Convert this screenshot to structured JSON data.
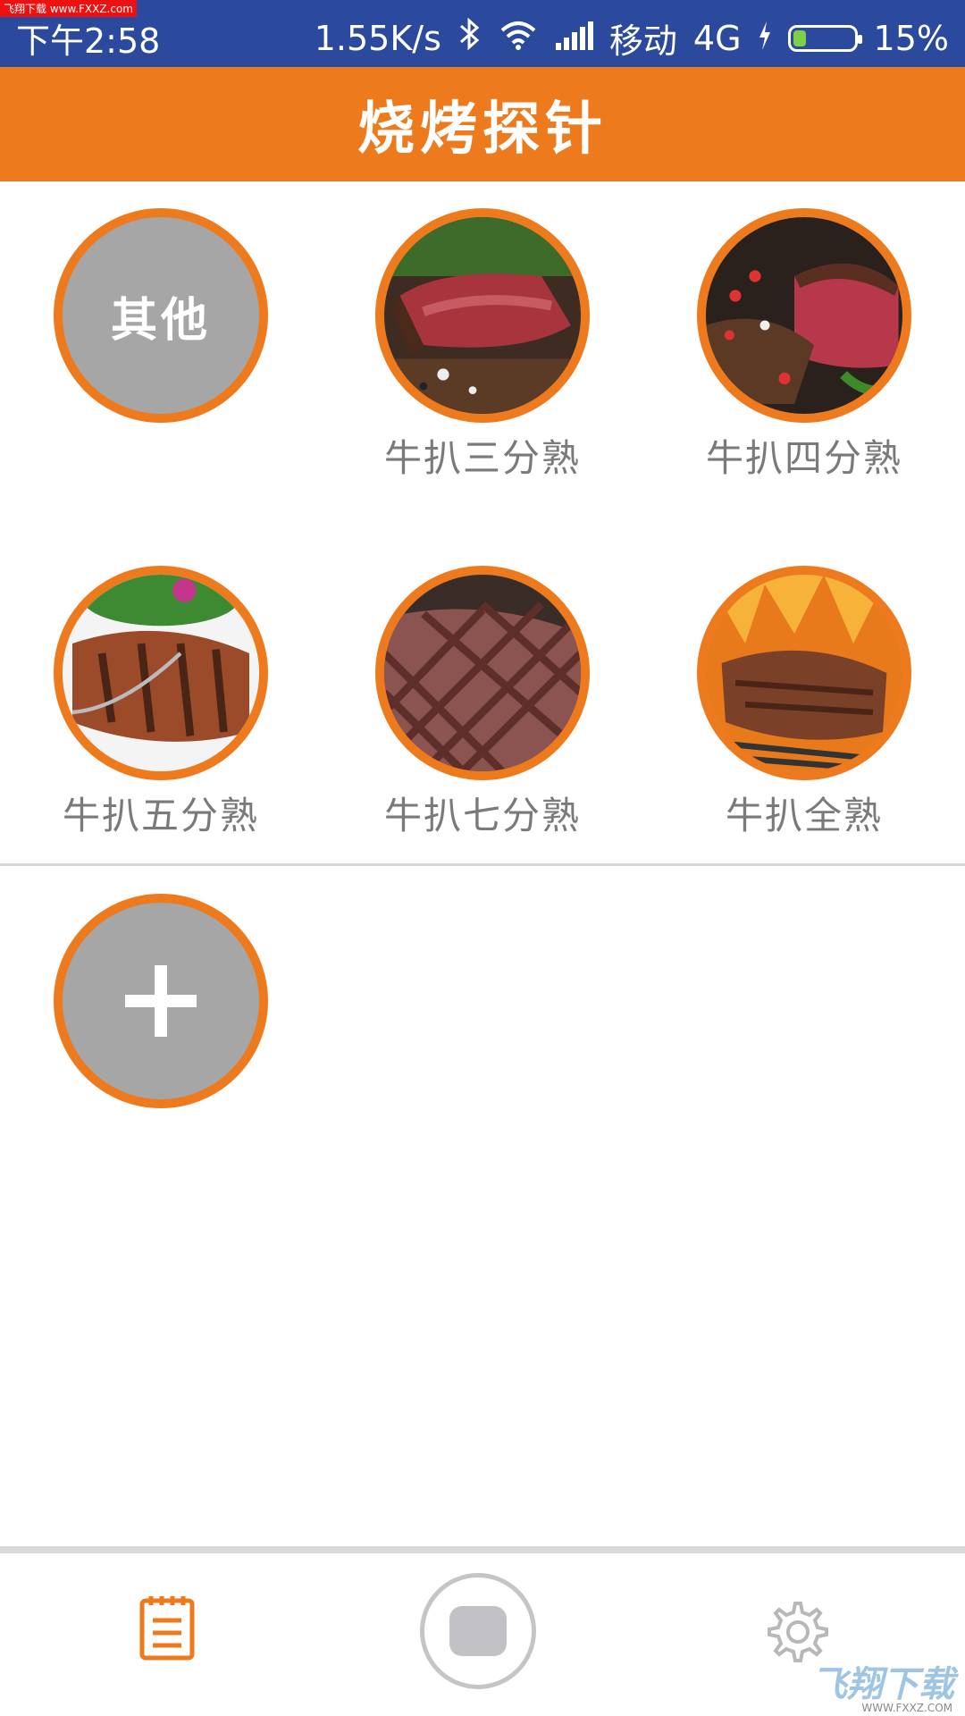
{
  "status_bar": {
    "watermark": "飞翔下载 www.FXXZ.com",
    "time": "下午2:58",
    "speed": "1.55K/s",
    "carrier": "移动",
    "network": "4G",
    "battery": "15%"
  },
  "header": {
    "title": "烧烤探针"
  },
  "presets": [
    {
      "label": "",
      "text": "其他",
      "image": "gray-circle"
    },
    {
      "label": "牛扒三分熟",
      "image": "steak-rare-icon"
    },
    {
      "label": "牛扒四分熟",
      "image": "steak-medium-rare-icon"
    },
    {
      "label": "牛扒五分熟",
      "image": "steak-medium-icon"
    },
    {
      "label": "牛扒七分熟",
      "image": "steak-medium-well-icon"
    },
    {
      "label": "牛扒全熟",
      "image": "steak-well-done-icon"
    }
  ],
  "add_button": {
    "icon": "plus-icon"
  },
  "bottom_nav": {
    "left_icon": "notepad-icon",
    "center_icon": "record-button",
    "right_icon": "gear-icon"
  },
  "watermark_logo": {
    "text": "飞翔下载",
    "url": "WWW.FXXZ.COM"
  },
  "colors": {
    "accent": "#ee7a1e",
    "statusbar": "#2b4a9e",
    "placeholder": "#a6a6a6"
  }
}
